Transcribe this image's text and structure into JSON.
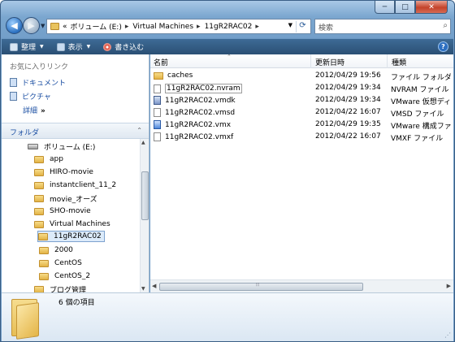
{
  "window": {
    "minimize_glyph": "─",
    "maximize_glyph": "□",
    "close_glyph": "✕"
  },
  "nav": {
    "back_glyph": "◀",
    "forward_glyph": "▶"
  },
  "address": {
    "prefix": "«",
    "crumbs": [
      "ボリューム (E:)",
      "Virtual Machines",
      "11gR2RAC02"
    ],
    "separator": "▸"
  },
  "search": {
    "placeholder": "検索"
  },
  "toolbar": {
    "organize": "整理",
    "views": "表示",
    "burn": "書き込む"
  },
  "favorites": {
    "title": "お気に入りリンク",
    "items": [
      "ドキュメント",
      "ピクチャ"
    ],
    "more": "詳細",
    "more_glyph": "»"
  },
  "folders": {
    "header": "フォルダ",
    "tree": [
      {
        "label": "ボリューム (E:)",
        "kind": "drive"
      },
      {
        "label": "app",
        "kind": "folder"
      },
      {
        "label": "HIRO-movie",
        "kind": "folder"
      },
      {
        "label": "instantclient_11_2",
        "kind": "folder"
      },
      {
        "label": "movie_オーズ",
        "kind": "folder"
      },
      {
        "label": "SHO-movie",
        "kind": "folder"
      },
      {
        "label": "Virtual Machines",
        "kind": "folder"
      },
      {
        "label": "11gR2RAC02",
        "kind": "folder",
        "selected": true
      },
      {
        "label": "2000",
        "kind": "folder"
      },
      {
        "label": "CentOS",
        "kind": "folder"
      },
      {
        "label": "CentOS_2",
        "kind": "folder"
      },
      {
        "label": "ブログ管理",
        "kind": "folder"
      }
    ]
  },
  "columns": {
    "name": "名前",
    "modified": "更新日時",
    "type": "種類"
  },
  "files": [
    {
      "name": "caches",
      "modified": "2012/04/29 19:56",
      "type": "ファイル フォルダ",
      "icon": "folder"
    },
    {
      "name": "11gR2RAC02.nvram",
      "modified": "2012/04/29 19:34",
      "type": "NVRAM ファイル",
      "icon": "file",
      "selected": true
    },
    {
      "name": "11gR2RAC02.vmdk",
      "modified": "2012/04/29 19:34",
      "type": "VMware 仮想ディ...",
      "icon": "vmdk"
    },
    {
      "name": "11gR2RAC02.vmsd",
      "modified": "2012/04/22 16:07",
      "type": "VMSD ファイル",
      "icon": "file"
    },
    {
      "name": "11gR2RAC02.vmx",
      "modified": "2012/04/29 19:35",
      "type": "VMware 構成ファ...",
      "icon": "vmx"
    },
    {
      "name": "11gR2RAC02.vmxf",
      "modified": "2012/04/22 16:07",
      "type": "VMXF ファイル",
      "icon": "file"
    }
  ],
  "status": {
    "item_count": "6 個の項目"
  }
}
